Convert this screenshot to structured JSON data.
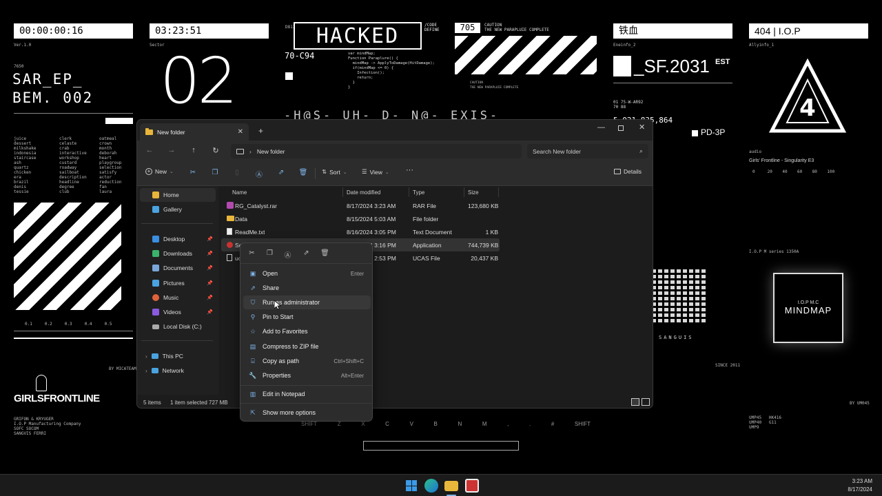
{
  "wallpaper": {
    "timer1": "00:00:00:16",
    "timer2": "03:23:51",
    "ver": "Ver.1.0",
    "sector": "Sector",
    "code_7650": "7650",
    "sar_line1": "SAR_EP_",
    "sar_line2": "BEM. 002",
    "big_number": "02",
    "d812": "D812",
    "hacked": "HACKED",
    "code_define": "/CODE\nDEFINE",
    "code_70c94": "70-C94",
    "code_snippet": "var mindMap;\nFunction Paraplure() {\n  mindMap -> ApplyToDamage(HitDamage);\n  if(mindMap <= 0) {\n    Infection();\n    return;\n  }\n}",
    "num_705": "705",
    "caution": "CAUTION\nTHE NEW PARAPLUIE COMPLETE",
    "caution_small": "CAUTION\nTHE NEW PARAPLUIE COMPLETE",
    "iron_blood": "铁血",
    "eneinfo": "Eneinfo_2",
    "sf_text": "_SF.2031",
    "sf_sup": "EST",
    "sf_code": "01 75-W-AR92\n70 88",
    "sf_num": "5,021,835,864",
    "pd3p": "PD-3P",
    "iop": "404 | I.O.P",
    "allyinfo": "Allyinfo_1",
    "audio": "audio",
    "singularity": "Girls' Frontline - Singularity E3",
    "scale": "0     20    40    60    80    100",
    "glitch_text": "-H@S- UH- D- N@- EXIS-",
    "mindmap_top": "I.O.P M.C",
    "mindmap": "MINDMAP",
    "iop_series": "I.O.P M series 1350A",
    "gfl": "GIRLSFRONTLINE",
    "gfl_credits": "GRIFON & KRYUGER\nI.O.P Manufacturing Company\nSOFC SOCOM\nSANGVIS FERRI",
    "by_micateam": "BY MICATEAM",
    "by_um": "BY UM045",
    "since": "SINCE 2011",
    "sanguis": "SANGUIS",
    "keyboard_keys": [
      "SHIFT",
      "Z",
      "X",
      "C",
      "V",
      "B",
      "N",
      "M",
      ",",
      ".",
      "#",
      "SHIFT"
    ],
    "wordlist1": "juice\ndessert\nmilkshake\nindonesia\nstaircase\nash\nquartz\nchicken\nera\nbrazil\ndenis\ntessie",
    "wordlist2": "clerk\ncelaste\ncrab\ninteractive\nworkshop\ncustard\nroadway\nsailboat\ndescription\nheadline\ndegree\nclub",
    "wordlist3": "oatmeal\ncrown\nmonth\ndeborah\nheart\nplaygroup\nselection\nsatisfy\nactor\nreduction\nfan\nlaura",
    "weapons": "UMP45   HK416\nUMP40   G11\nUMP9",
    "axis": "0.1     0.2     0.3     0.4     0.5"
  },
  "explorer": {
    "tab_title": "New folder",
    "breadcrumb": "New folder",
    "search_placeholder": "Search New folder",
    "cmd": {
      "new": "New",
      "sort": "Sort",
      "view": "View",
      "more": "···",
      "details": "Details"
    },
    "sidebar": [
      {
        "label": "Home",
        "icon": "home-icon",
        "color": "#e8b63a"
      },
      {
        "label": "Gallery",
        "icon": "gallery-icon",
        "color": "#4aa3e0"
      },
      {
        "label": "Desktop",
        "icon": "desktop-icon",
        "color": "#3b8ee0"
      },
      {
        "label": "Downloads",
        "icon": "downloads-icon",
        "color": "#3bb36b"
      },
      {
        "label": "Documents",
        "icon": "documents-icon",
        "color": "#7aa7d8"
      },
      {
        "label": "Pictures",
        "icon": "pictures-icon",
        "color": "#4aa3e0"
      },
      {
        "label": "Music",
        "icon": "music-icon",
        "color": "#e0623b"
      },
      {
        "label": "Videos",
        "icon": "videos-icon",
        "color": "#8a5ae0"
      },
      {
        "label": "Local Disk (C:)",
        "icon": "disk-icon",
        "color": "#aaaaaa"
      },
      {
        "label": "This PC",
        "icon": "pc-icon",
        "color": "#4aa3e0"
      },
      {
        "label": "Network",
        "icon": "network-icon",
        "color": "#4aa3e0"
      }
    ],
    "columns": {
      "name": "Name",
      "date": "Date modified",
      "type": "Type",
      "size": "Size"
    },
    "files": [
      {
        "name": "RG_Catalyst.rar",
        "date": "8/17/2024 3:23 AM",
        "type": "RAR File",
        "size": "123,680 KB"
      },
      {
        "name": "Data",
        "date": "8/15/2024 5:03 AM",
        "type": "File folder",
        "size": ""
      },
      {
        "name": "ReadMe.txt",
        "date": "8/16/2024 3:05 PM",
        "type": "Text Document",
        "size": "1 KB"
      },
      {
        "name": "Setup",
        "date": "8/16/2024 3:16 PM",
        "type": "Application",
        "size": "744,739 KB"
      },
      {
        "name": "ucas",
        "date": "8/16/2024 2:53 PM",
        "type": "UCAS File",
        "size": "20,437 KB"
      }
    ],
    "status": {
      "items": "5 items",
      "selected": "1 item selected  727 MB"
    }
  },
  "context_menu": {
    "items": [
      {
        "label": "Open",
        "shortcut": "Enter",
        "icon": "open-icon"
      },
      {
        "label": "Share",
        "shortcut": "",
        "icon": "share-icon"
      },
      {
        "label": "Run as administrator",
        "shortcut": "",
        "icon": "shield-icon"
      },
      {
        "label": "Pin to Start",
        "shortcut": "",
        "icon": "pin-icon"
      },
      {
        "label": "Add to Favorites",
        "shortcut": "",
        "icon": "star-icon"
      },
      {
        "label": "Compress to ZIP file",
        "shortcut": "",
        "icon": "zip-icon"
      },
      {
        "label": "Copy as path",
        "shortcut": "Ctrl+Shift+C",
        "icon": "path-icon"
      },
      {
        "label": "Properties",
        "shortcut": "Alt+Enter",
        "icon": "wrench-icon"
      },
      {
        "label": "Edit in Notepad",
        "shortcut": "",
        "icon": "notepad-icon"
      },
      {
        "label": "Show more options",
        "shortcut": "",
        "icon": "more-options-icon"
      }
    ]
  },
  "taskbar": {
    "time": "3:23 AM",
    "date": "8/17/2024"
  }
}
